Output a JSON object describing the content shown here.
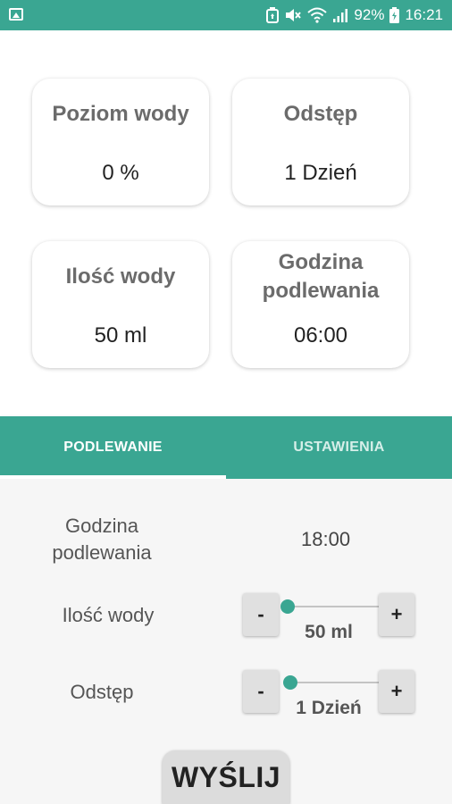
{
  "status_bar": {
    "battery_percent": "92%",
    "time": "16:21",
    "icons": [
      "image-icon",
      "battery-saver-icon",
      "mute-icon",
      "wifi-icon",
      "signal-icon",
      "battery-icon"
    ]
  },
  "cards": {
    "water_level": {
      "title": "Poziom wody",
      "value": "0 %"
    },
    "interval": {
      "title": "Odstęp",
      "value": "1 Dzień"
    },
    "water_amount": {
      "title": "Ilość wody",
      "value": "50 ml"
    },
    "watering_time": {
      "title_line1": "Godzina",
      "title_line2": "podlewania",
      "value": "06:00"
    }
  },
  "tabs": {
    "watering": "PODLEWANIE",
    "settings": "USTAWIENIA"
  },
  "form": {
    "time_label_line1": "Godzina",
    "time_label_line2": "podlewania",
    "time_value": "18:00",
    "amount_label": "Ilość wody",
    "amount_value": "50 ml",
    "amount_slider_fraction": 0,
    "interval_label": "Odstęp",
    "interval_value": "1 Dzień",
    "interval_slider_fraction": 0,
    "minus": "-",
    "plus": "+"
  },
  "send_button": "WYŚLIJ",
  "colors": {
    "accent": "#3aa692",
    "panel_bg": "#f6f6f6"
  }
}
